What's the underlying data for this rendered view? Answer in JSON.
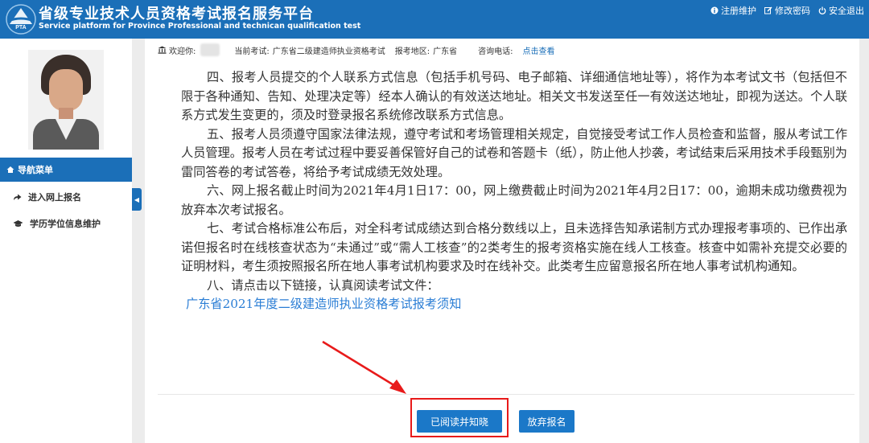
{
  "header": {
    "logo_text": "PTA",
    "title_cn": "省级专业技术人员资格考试报名服务平台",
    "title_en": "Service platform for Province Professional and technican qualification test",
    "links": [
      {
        "icon": "info-icon",
        "label": "注册维护"
      },
      {
        "icon": "edit-icon",
        "label": "修改密码"
      },
      {
        "icon": "power-icon",
        "label": "安全退出"
      }
    ]
  },
  "sidebar": {
    "nav_header": "导航菜单",
    "items": [
      {
        "icon": "share-arrow-icon",
        "label": "进入网上报名"
      },
      {
        "icon": "graduation-cap-icon",
        "label": "学历学位信息维护"
      }
    ]
  },
  "infobar": {
    "welcome": "欢迎你:",
    "exam_label": "当前考试:",
    "exam_value": "广东省二级建造师执业资格考试",
    "region_label": "报考地区:",
    "region_value": "广东省",
    "phone_label": "咨询电话:",
    "phone_link": "点击查看"
  },
  "article": {
    "paragraphs": [
      "四、报考人员提交的个人联系方式信息（包括手机号码、电子邮箱、详细通信地址等），将作为本考试文书（包括但不限于各种通知、告知、处理决定等）经本人确认的有效送达地址。相关文书发送至任一有效送达地址，即视为送达。个人联系方式发生变更的，须及时登录报名系统修改联系方式信息。",
      "五、报考人员须遵守国家法律法规，遵守考试和考场管理相关规定，自觉接受考试工作人员检查和监督，服从考试工作人员管理。报考人员在考试过程中要妥善保管好自己的试卷和答题卡（纸），防止他人抄袭，考试结束后采用技术手段甄别为雷同答卷的考试答卷，将给予考试成绩无效处理。",
      "六、网上报名截止时间为2021年4月1日17：00，网上缴费截止时间为2021年4月2日17：00，逾期未成功缴费视为放弃本次考试报名。",
      "七、考试合格标准公布后，对全科考试成绩达到合格分数线以上，且未选择告知承诺制方式办理报考事项的、已作出承诺但报名时在线核查状态为“未通过”或“需人工核查”的2类考生的报考资格实施在线人工核查。核查中如需补充提交必要的证明材料，考生须按照报名所在地人事考试机构要求及时在线补交。此类考生应留意报名所在地人事考试机构通知。",
      "八、请点击以下链接，认真阅读考试文件："
    ],
    "doc_link": "广东省2021年度二级建造师执业资格考试报考须知"
  },
  "buttons": {
    "confirm": "已阅读并知晓",
    "abandon": "放弃报名"
  },
  "colors": {
    "primary": "#1b6fb8",
    "button": "#1b78c8",
    "annotation": "#e81a1a",
    "link": "#2b7ed5"
  }
}
